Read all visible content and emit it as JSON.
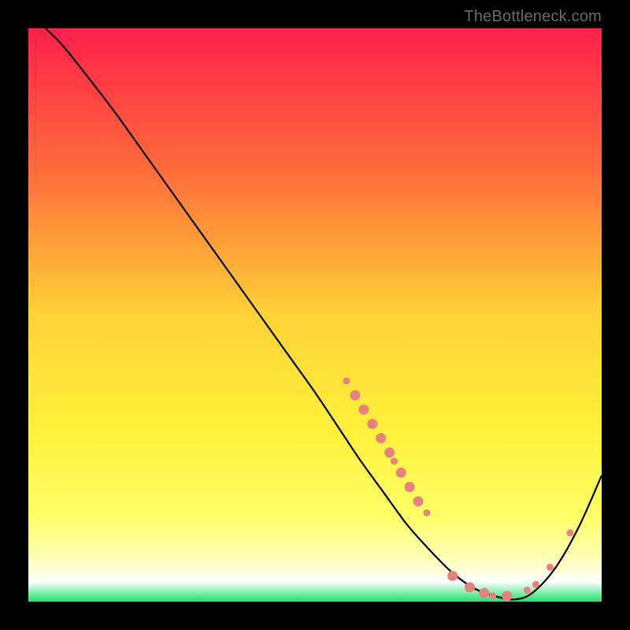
{
  "attribution": "TheBottleneck.com",
  "chart_data": {
    "type": "line",
    "title": "",
    "xlabel": "",
    "ylabel": "",
    "xlim": [
      0,
      100
    ],
    "ylim": [
      0,
      100
    ],
    "grid": false,
    "legend": false,
    "background_gradient": {
      "stops": [
        {
          "offset": 0.0,
          "color": "#ff1f4b"
        },
        {
          "offset": 0.25,
          "color": "#ff6d3a"
        },
        {
          "offset": 0.5,
          "color": "#ffd236"
        },
        {
          "offset": 0.7,
          "color": "#fff13b"
        },
        {
          "offset": 0.85,
          "color": "#ffff66"
        },
        {
          "offset": 0.93,
          "color": "#ffffbd"
        },
        {
          "offset": 0.965,
          "color": "#ffffff"
        },
        {
          "offset": 1.0,
          "color": "#1ee26b"
        }
      ]
    },
    "series": [
      {
        "name": "bottleneck-curve",
        "color": "#000000",
        "x": [
          3,
          6,
          10,
          15,
          20,
          25,
          30,
          35,
          40,
          45,
          50,
          55,
          58,
          62,
          66,
          70,
          74,
          78,
          82,
          85,
          88,
          92,
          96,
          100
        ],
        "y": [
          100,
          97,
          92,
          85.5,
          78.5,
          71.5,
          64.5,
          57.5,
          50.5,
          43.5,
          36.5,
          29,
          24.5,
          19,
          13.5,
          9,
          5,
          2.2,
          0.8,
          0.4,
          1.6,
          6,
          13,
          22
        ]
      }
    ],
    "markers": {
      "name": "highlight-points",
      "color": "#e6817e",
      "radius_small": 4.5,
      "radius_large": 6.5,
      "points": [
        {
          "x": 55.5,
          "y": 38.5,
          "r": "small"
        },
        {
          "x": 57.0,
          "y": 36.0,
          "r": "large"
        },
        {
          "x": 58.5,
          "y": 33.5,
          "r": "large"
        },
        {
          "x": 60.0,
          "y": 31.0,
          "r": "large"
        },
        {
          "x": 61.5,
          "y": 28.5,
          "r": "large"
        },
        {
          "x": 63.0,
          "y": 26.0,
          "r": "large"
        },
        {
          "x": 63.8,
          "y": 24.5,
          "r": "small"
        },
        {
          "x": 65.0,
          "y": 22.5,
          "r": "large"
        },
        {
          "x": 66.5,
          "y": 20.0,
          "r": "large"
        },
        {
          "x": 68.0,
          "y": 17.5,
          "r": "large"
        },
        {
          "x": 69.5,
          "y": 15.5,
          "r": "small"
        },
        {
          "x": 74.0,
          "y": 4.5,
          "r": "large"
        },
        {
          "x": 77.0,
          "y": 2.5,
          "r": "large"
        },
        {
          "x": 79.5,
          "y": 1.5,
          "r": "large"
        },
        {
          "x": 81.0,
          "y": 1.0,
          "r": "small"
        },
        {
          "x": 83.5,
          "y": 1.0,
          "r": "large"
        },
        {
          "x": 87.0,
          "y": 2.0,
          "r": "small"
        },
        {
          "x": 88.5,
          "y": 3.0,
          "r": "small"
        },
        {
          "x": 91.0,
          "y": 6.0,
          "r": "small"
        },
        {
          "x": 94.5,
          "y": 12.0,
          "r": "small"
        }
      ]
    }
  }
}
